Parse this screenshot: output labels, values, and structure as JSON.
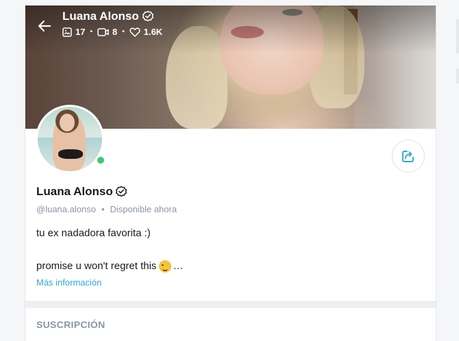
{
  "cover": {
    "name": "Luana Alonso",
    "stats": [
      {
        "icon": "image-icon",
        "value": "17"
      },
      {
        "icon": "video-icon",
        "value": "8"
      },
      {
        "icon": "heart-icon",
        "value": "1.6K"
      }
    ]
  },
  "profile": {
    "name": "Luana Alonso",
    "handle": "@luana.alonso",
    "separator": "•",
    "status": "Disponible ahora",
    "bio_line1": "tu ex nadadora favorita :)",
    "bio_line2": "promise u won't regret this",
    "bio_ellipsis": "…",
    "more_label": "Más información"
  },
  "section": {
    "title": "SUSCRIPCIÓN"
  },
  "colors": {
    "accent": "#2fa9d3",
    "online": "#3cc774",
    "muted": "#8a96a3"
  }
}
